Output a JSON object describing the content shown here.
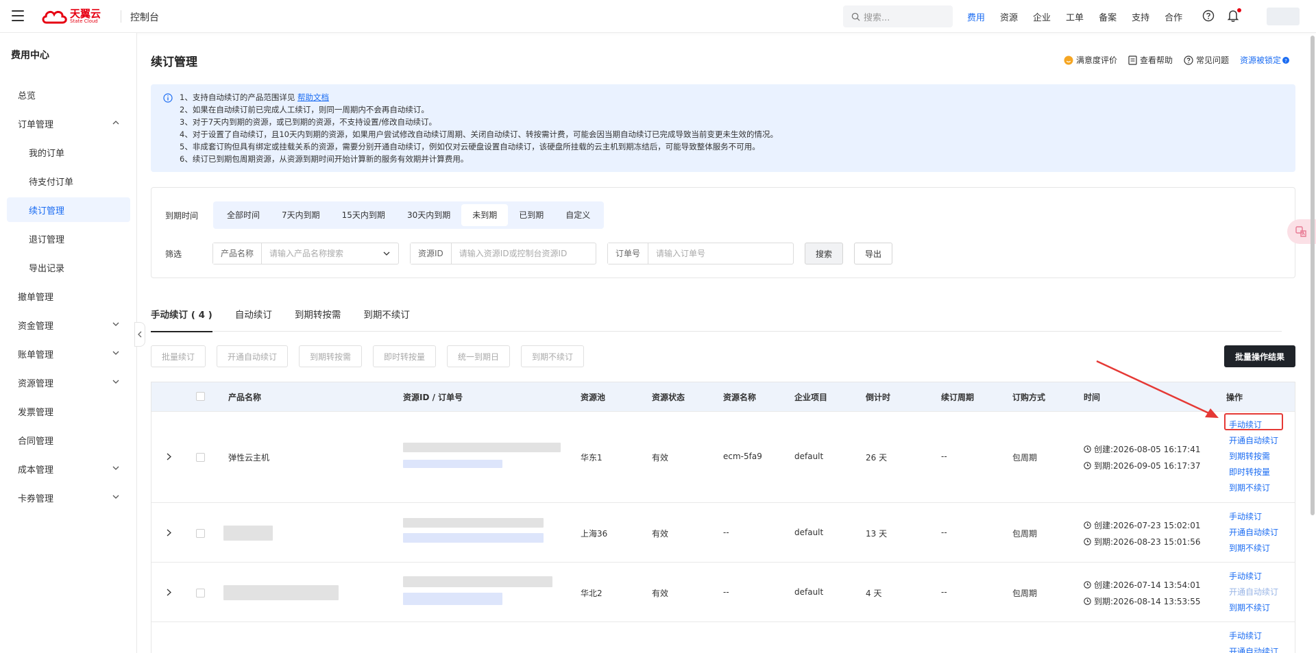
{
  "topbar": {
    "brand": "天翼云",
    "brand_en": "State Cloud",
    "console": "控制台",
    "search_placeholder": "搜索...",
    "nav": [
      "费用",
      "资源",
      "企业",
      "工单",
      "备案",
      "支持",
      "合作"
    ],
    "active_nav": "费用"
  },
  "sidebar": {
    "title": "费用中心",
    "items": [
      {
        "label": "总览"
      },
      {
        "label": "订单管理"
      },
      {
        "label": "我的订单"
      },
      {
        "label": "待支付订单"
      },
      {
        "label": "续订管理"
      },
      {
        "label": "退订管理"
      },
      {
        "label": "导出记录"
      },
      {
        "label": "撤单管理"
      },
      {
        "label": "资金管理"
      },
      {
        "label": "账单管理"
      },
      {
        "label": "资源管理"
      },
      {
        "label": "发票管理"
      },
      {
        "label": "合同管理"
      },
      {
        "label": "成本管理"
      },
      {
        "label": "卡券管理"
      }
    ]
  },
  "page": {
    "title": "续订管理",
    "links": [
      "满意度评价",
      "查看帮助",
      "常见问题",
      "资源被锁定"
    ]
  },
  "notice": {
    "line1_prefix": "1、支持自动续订的产品范围详见",
    "line1_link": "帮助文档",
    "lines": [
      "2、如果在自动续订前已完成人工续订，则同一周期内不会再自动续订。",
      "3、对于7天内到期的资源，或已到期的资源，不支持设置/修改自动续订。",
      "4、对于设置了自动续订，且10天内到期的资源，如果用户尝试修改自动续订周期、关闭自动续订、转按需计费，可能会因当期自动续订已完成导致当前变更未生效的情况。",
      "5、非成套订购但具有绑定或挂载关系的资源，需要分别开通自动续订，例如仅对云硬盘设置自动续订，该硬盘所挂载的云主机到期冻结后，可能导致整体服务不可用。",
      "6、续订已到期包周期资源，从资源到期时间开始计算新的服务有效期并计算费用。"
    ]
  },
  "filters": {
    "expire_label": "到期时间",
    "expire_options": [
      "全部时间",
      "7天内到期",
      "15天内到期",
      "30天内到期",
      "未到期",
      "已到期",
      "自定义"
    ],
    "expire_selected": "未到期",
    "filter_label": "筛选",
    "product_prefix": "产品名称",
    "product_placeholder": "请输入产品名称搜索",
    "resource_prefix": "资源ID",
    "resource_placeholder": "请输入资源ID或控制台资源ID",
    "order_prefix": "订单号",
    "order_placeholder": "请输入订单号",
    "search_btn": "搜索",
    "export_btn": "导出"
  },
  "tabs": [
    "手动续订 ( 4 )",
    "自动续订",
    "到期转按需",
    "到期不续订"
  ],
  "actions": [
    "批量续订",
    "开通自动续订",
    "到期转按需",
    "即时转按量",
    "统一到期日",
    "到期不续订"
  ],
  "batch_result": "批量操作结果",
  "table": {
    "headers": [
      "产品名称",
      "资源ID / 订单号",
      "资源池",
      "资源状态",
      "资源名称",
      "企业项目",
      "倒计时",
      "续订周期",
      "订购方式",
      "时间",
      "操作"
    ],
    "rows": [
      {
        "product": "弹性云主机",
        "pool": "华东1",
        "status": "有效",
        "name": "ecm-5fa9",
        "project": "default",
        "countdown": "26 天",
        "cycle": "--",
        "mode": "包周期",
        "created": "创建:2026-08-05 16:17:41",
        "expires": "到期:2026-09-05 16:17:37",
        "ops": [
          "手动续订",
          "开通自动续订",
          "到期转按需",
          "即时转按量",
          "到期不续订"
        ]
      },
      {
        "product": "",
        "pool": "上海36",
        "status": "有效",
        "name": "--",
        "project": "default",
        "countdown": "13 天",
        "cycle": "--",
        "mode": "包周期",
        "created": "创建:2026-07-23 15:02:01",
        "expires": "到期:2026-08-23 15:01:56",
        "ops": [
          "手动续订",
          "开通自动续订",
          "到期不续订"
        ]
      },
      {
        "product": "",
        "pool": "华北2",
        "status": "有效",
        "name": "--",
        "project": "default",
        "countdown": "4 天",
        "cycle": "--",
        "mode": "包周期",
        "created": "创建:2026-07-14 13:54:01",
        "expires": "到期:2026-08-14 13:53:55",
        "ops": [
          "手动续订",
          "开通自动续订",
          "到期不续订"
        ]
      },
      {
        "ops": [
          "手动续订",
          "开通自动续订"
        ]
      }
    ]
  },
  "colors": {
    "accent": "#1b6cf2",
    "brand": "#e60012",
    "highlight": "#e53935"
  }
}
